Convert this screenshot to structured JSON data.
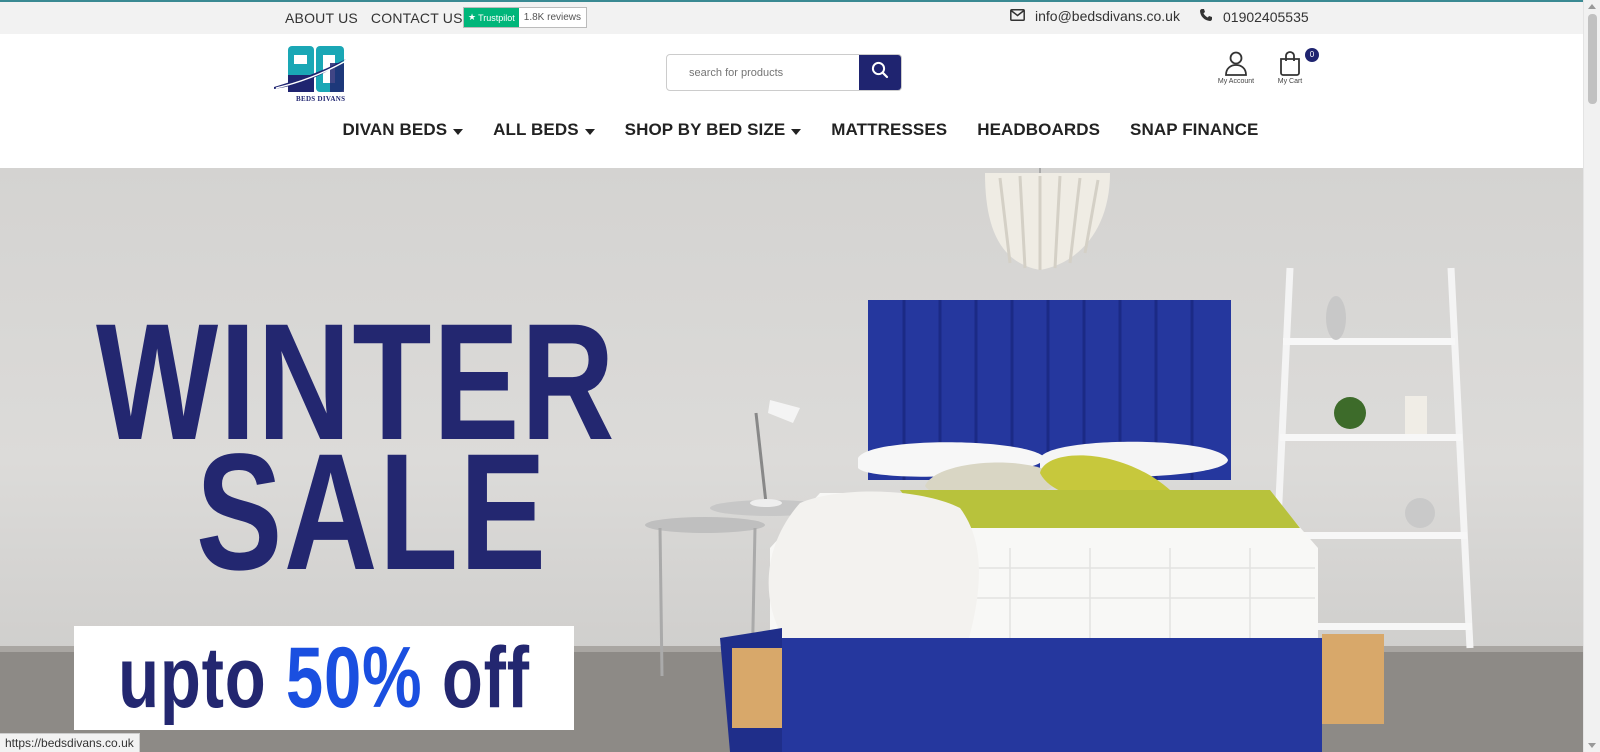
{
  "topbar": {
    "about_label": "ABOUT US",
    "contact_label": "CONTACT US",
    "trustpilot_label": "Trustpilot",
    "trustpilot_reviews": "1.8K reviews",
    "email": "info@bedsdivans.co.uk",
    "phone": "01902405535"
  },
  "header": {
    "logo_text": "BEDS DIVANS",
    "search_placeholder": "search for products",
    "account_label": "My Account",
    "cart_label": "My Cart",
    "cart_count": "0"
  },
  "nav": {
    "items": [
      {
        "label": "DIVAN BEDS",
        "has_dropdown": true
      },
      {
        "label": "ALL BEDS",
        "has_dropdown": true
      },
      {
        "label": "SHOP BY BED SIZE",
        "has_dropdown": true
      },
      {
        "label": "MATTRESSES",
        "has_dropdown": false
      },
      {
        "label": "HEADBOARDS",
        "has_dropdown": false
      },
      {
        "label": "SNAP FINANCE",
        "has_dropdown": false
      }
    ]
  },
  "hero": {
    "line1": "WINTER",
    "line2": "SALE",
    "offer_prefix": "upto ",
    "offer_highlight": "50%",
    "offer_suffix": " off"
  },
  "status_url": "https://bedsdivans.co.uk",
  "colors": {
    "brand_navy": "#1f2470",
    "offer_blue": "#1a4fe0",
    "trustpilot_green": "#00b67a",
    "logo_teal": "#1aa7b5"
  }
}
